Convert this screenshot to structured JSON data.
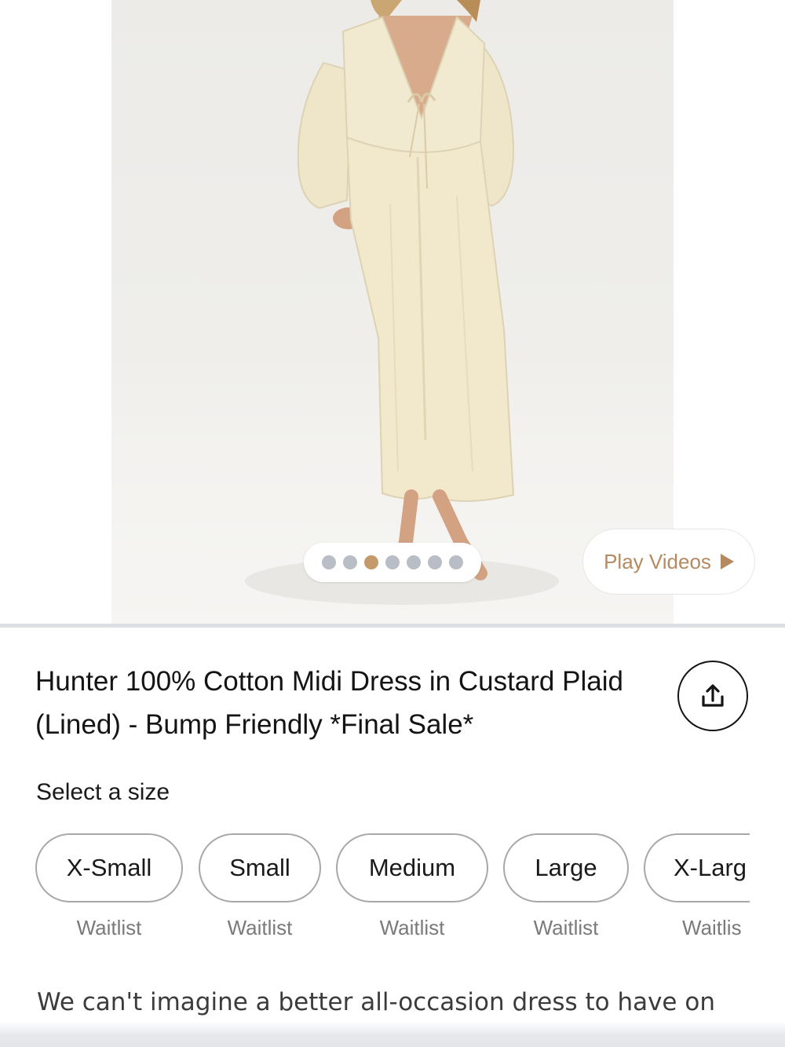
{
  "hero": {
    "image_description_icon": "product-photo",
    "carousel": {
      "total_dots": 7,
      "active_index": 2
    },
    "play_videos_label": "Play Videos",
    "accent_color": "#b58a60"
  },
  "product": {
    "title": "Hunter 100% Cotton Midi Dress in Custard Plaid (Lined) - Bump Friendly *Final Sale*",
    "share_icon": "share-icon"
  },
  "size_selector": {
    "label": "Select a size",
    "sizes": [
      {
        "name": "X-Small",
        "status": "Waitlist"
      },
      {
        "name": "Small",
        "status": "Waitlist"
      },
      {
        "name": "Medium",
        "status": "Waitlist"
      },
      {
        "name": "Large",
        "status": "Waitlist"
      },
      {
        "name": "X-Larg",
        "status": "Waitlis"
      }
    ]
  },
  "description": {
    "text": "We can't imagine a better all-occasion dress to have on"
  }
}
